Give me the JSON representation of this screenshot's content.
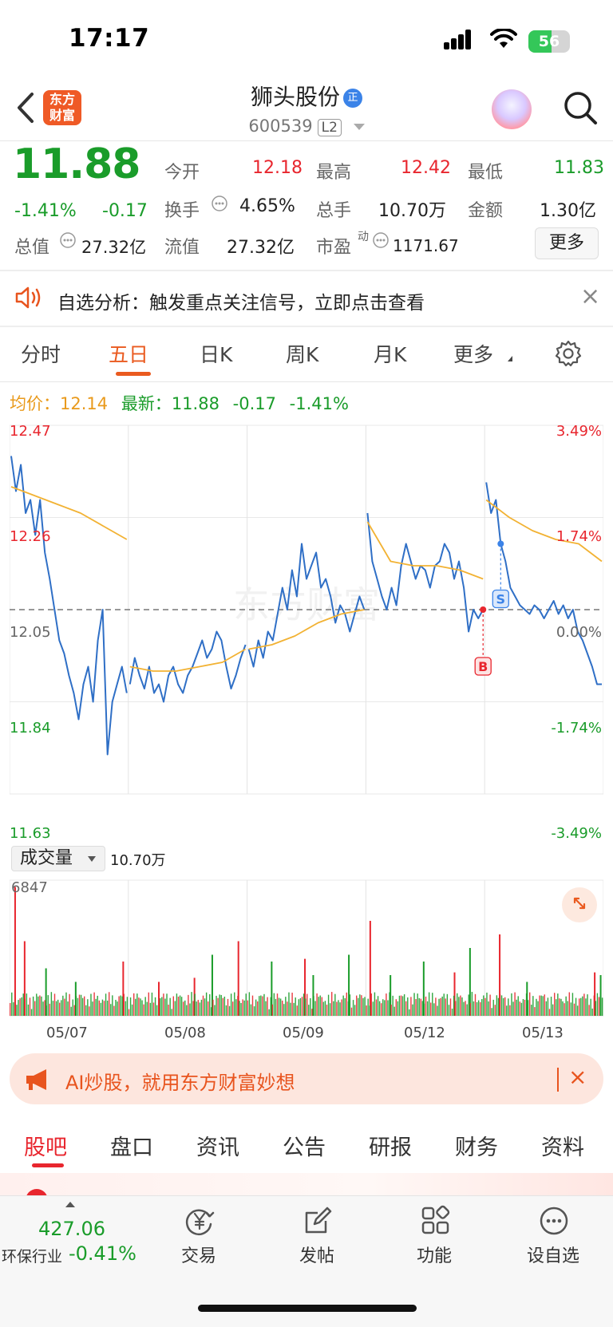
{
  "status": {
    "time": "17:17",
    "battery": "56",
    "battery_level": 0.56
  },
  "header": {
    "logo_line1": "东方",
    "logo_line2": "财富",
    "stock_name": "狮头股份",
    "badge": "正",
    "stock_code": "600539",
    "level_badge": "L2"
  },
  "quote": {
    "price": "11.88",
    "change_pct": "-1.41%",
    "change_abs": "-0.17",
    "open_label": "今开",
    "open": "12.18",
    "high_label": "最高",
    "high": "12.42",
    "low_label": "最低",
    "low": "11.83",
    "turnover_label": "换手",
    "turnover": "4.65%",
    "volume_label": "总手",
    "volume": "10.70万",
    "amount_label": "金额",
    "amount": "1.30亿",
    "mktcap_label": "总值",
    "mktcap": "27.32亿",
    "float_label": "流值",
    "float_cap": "27.32亿",
    "pe_label": "市盈",
    "pe_sup": "动",
    "pe": "1171.67",
    "more_label": "更多"
  },
  "signal": {
    "text": "自选分析：触发重点关注信号，立即点击查看",
    "close": "×"
  },
  "period_tabs": [
    "分时",
    "五日",
    "日K",
    "周K",
    "月K",
    "更多"
  ],
  "active_tab": "五日",
  "info_row": {
    "avg_label": "均价：",
    "avg": "12.14",
    "latest_label": "最新：",
    "latest": "11.88",
    "chg": "-0.17",
    "pct": "-1.41%"
  },
  "chart_data": {
    "type": "line",
    "x_dates": [
      "05/07",
      "05/08",
      "05/09",
      "05/12",
      "05/13"
    ],
    "ylim": [
      11.63,
      12.47
    ],
    "y_ticks": [
      "12.47",
      "12.26",
      "12.05",
      "11.84",
      "11.63"
    ],
    "pct_ticks": [
      "3.49%",
      "1.74%",
      "0.00%",
      "-1.74%",
      "-3.49%"
    ],
    "prev_close": 12.05,
    "watermark": "东方财富",
    "markers": [
      {
        "label": "S",
        "day": 4
      },
      {
        "label": "B",
        "day": 3
      }
    ],
    "series": [
      {
        "name": "price",
        "color": "#2f6fc6",
        "days": [
          [
            12.4,
            12.32,
            12.38,
            12.27,
            12.3,
            12.22,
            12.3,
            12.18,
            12.12,
            12.05,
            11.98,
            11.95,
            11.9,
            11.86,
            11.8,
            11.88,
            11.92,
            11.84,
            11.98,
            12.05,
            11.72,
            11.84,
            11.88,
            11.92,
            11.86
          ],
          [
            11.88,
            11.94,
            11.9,
            11.87,
            11.92,
            11.86,
            11.88,
            11.84,
            11.9,
            11.92,
            11.88,
            11.86,
            11.9,
            11.92,
            11.95,
            11.98,
            11.94,
            11.96,
            12.0,
            11.98,
            11.92,
            11.87,
            11.9,
            11.94,
            11.97
          ],
          [
            11.96,
            11.92,
            11.98,
            11.94,
            12.0,
            11.98,
            12.04,
            12.1,
            12.05,
            12.14,
            12.08,
            12.2,
            12.12,
            12.15,
            12.18,
            12.1,
            12.12,
            12.08,
            12.02,
            12.06,
            12.04,
            12.0,
            12.04,
            12.08,
            12.05
          ],
          [
            12.27,
            12.16,
            12.12,
            12.08,
            12.05,
            12.1,
            12.06,
            12.15,
            12.2,
            12.16,
            12.12,
            12.15,
            12.14,
            12.1,
            12.15,
            12.16,
            12.2,
            12.18,
            12.12,
            12.16,
            12.1,
            12.0,
            12.05,
            12.03,
            12.05
          ],
          [
            12.34,
            12.27,
            12.3,
            12.2,
            12.16,
            12.1,
            12.08,
            12.06,
            12.05,
            12.04,
            12.06,
            12.05,
            12.03,
            12.05,
            12.07,
            12.04,
            12.06,
            12.03,
            12.05,
            12.0,
            11.98,
            11.95,
            11.92,
            11.88,
            11.88
          ]
        ]
      },
      {
        "name": "avg",
        "color": "#f2b233",
        "days": [
          [
            12.33,
            12.31,
            12.29,
            12.27,
            12.24,
            12.21
          ],
          [
            11.92,
            11.91,
            11.91,
            11.92,
            11.93,
            11.96
          ],
          [
            11.96,
            11.97,
            11.99,
            12.02,
            12.04,
            12.05
          ],
          [
            12.25,
            12.16,
            12.15,
            12.15,
            12.14,
            12.12
          ],
          [
            12.3,
            12.26,
            12.23,
            12.21,
            12.2,
            12.16
          ]
        ]
      }
    ]
  },
  "volume": {
    "label": "成交量",
    "total": "10.70万",
    "max_label": "6847",
    "bars": [
      {
        "d": 0.12,
        "h": 0.55,
        "c": "red"
      },
      {
        "d": 0.04,
        "h": 0.95,
        "c": "red"
      },
      {
        "d": 0.3,
        "h": 0.35,
        "c": "green"
      },
      {
        "d": 0.55,
        "h": 0.25,
        "c": "green"
      },
      {
        "d": 0.95,
        "h": 0.4,
        "c": "red"
      },
      {
        "d": 1.25,
        "h": 0.25,
        "c": "red"
      },
      {
        "d": 1.7,
        "h": 0.45,
        "c": "green"
      },
      {
        "d": 1.55,
        "h": 0.28,
        "c": "red"
      },
      {
        "d": 1.92,
        "h": 0.55,
        "c": "red"
      },
      {
        "d": 2.2,
        "h": 0.4,
        "c": "green"
      },
      {
        "d": 2.48,
        "h": 0.42,
        "c": "red"
      },
      {
        "d": 2.55,
        "h": 0.3,
        "c": "green"
      },
      {
        "d": 2.85,
        "h": 0.45,
        "c": "green"
      },
      {
        "d": 3.03,
        "h": 0.7,
        "c": "red"
      },
      {
        "d": 3.2,
        "h": 0.3,
        "c": "green"
      },
      {
        "d": 3.48,
        "h": 0.4,
        "c": "green"
      },
      {
        "d": 3.74,
        "h": 0.32,
        "c": "red"
      },
      {
        "d": 3.87,
        "h": 0.5,
        "c": "green"
      },
      {
        "d": 4.12,
        "h": 0.6,
        "c": "red"
      },
      {
        "d": 4.35,
        "h": 0.25,
        "c": "green"
      },
      {
        "d": 4.92,
        "h": 0.32,
        "c": "red"
      },
      {
        "d": 4.97,
        "h": 0.3,
        "c": "green"
      }
    ]
  },
  "ai_banner": {
    "text": "AI炒股，就用东方财富妙想",
    "close": "×"
  },
  "bottom_tabs": [
    "股吧",
    "盘口",
    "资讯",
    "公告",
    "研报",
    "财务",
    "资料"
  ],
  "nav": {
    "index_value": "427.06",
    "index_name": "环保行业",
    "index_change": "-0.41%",
    "trade": "交易",
    "post": "发帖",
    "func": "功能",
    "watch": "设自选"
  }
}
